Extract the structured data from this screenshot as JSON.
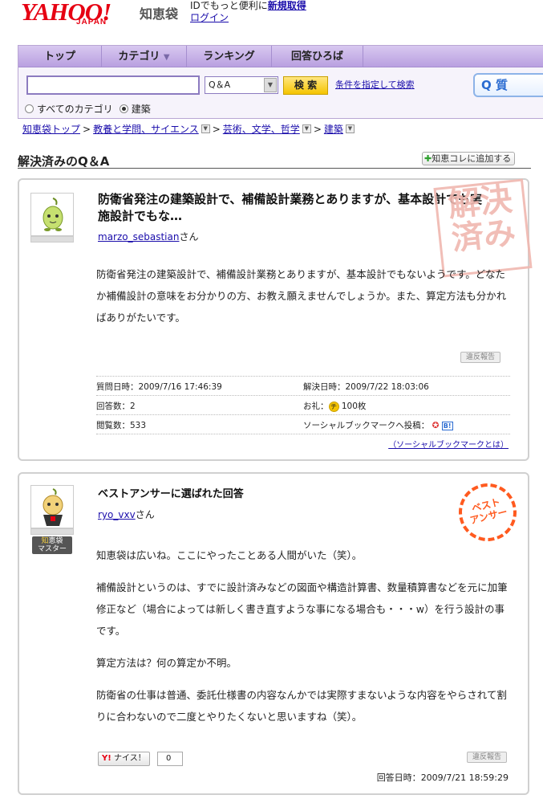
{
  "header": {
    "logo_text": "YAHOO!",
    "logo_sub": "JAPAN",
    "service_name": "知恵袋",
    "promo_text": "IDでもっと便利に",
    "register_link": "新規取得",
    "login_link": "ログイン"
  },
  "nav": {
    "tabs": [
      {
        "label": "トップ",
        "has_dropdown": false
      },
      {
        "label": "カテゴリ",
        "has_dropdown": true
      },
      {
        "label": "ランキング",
        "has_dropdown": false
      },
      {
        "label": "回答ひろば",
        "has_dropdown": false
      }
    ],
    "search_value": "",
    "search_scope": "Q＆A",
    "search_button": "検 索",
    "advanced_link": "条件を指定して検索",
    "ask_button": "質",
    "radio_all": "すべてのカテゴリ",
    "radio_current": "建築",
    "radio_selected": "建築"
  },
  "breadcrumb": [
    "知恵袋トップ",
    "教養と学問、サイエンス",
    "芸術、文学、哲学",
    "建築"
  ],
  "section": {
    "title": "解決済みのQ＆A",
    "add_button": "知恵コレに追加する"
  },
  "question": {
    "title": "防衛省発注の建築設計で、補備設計業務とありますが、基本設計でも実施設計でもな…",
    "user": "marzo_sebastian",
    "user_suffix": "さん",
    "stamp": "解決済み",
    "body": "防衛省発注の建築設計で、補備設計業務とありますが、基本設計でもないようです。どなたか補備設計の意味をお分かりの方、お教え願えませんでしょうか。また、算定方法も分かればありがたいです。",
    "report_label": "違反報告",
    "asked_label": "質問日時：",
    "asked_value": "2009/7/16 17:46:39",
    "solved_label": "解決日時：",
    "solved_value": "2009/7/22 18:03:06",
    "answers_label": "回答数：",
    "answers_value": "2",
    "reward_label": "お礼：",
    "reward_value": "100枚",
    "views_label": "閲覧数：",
    "views_value": "533",
    "social_label": "ソーシャルブックマークへ投稿：",
    "social_note": "（ソーシャルブックマークとは）"
  },
  "answer": {
    "heading": "ベストアンサーに選ばれた回答",
    "user": "ryo_vxv",
    "user_suffix": "さん",
    "stamp": "ベストアンサー",
    "badge_line1_a": "知",
    "badge_line1_b": "恵袋",
    "badge_line2": "マスター",
    "paragraphs": [
      "知恵袋は広いね。ここにやったことある人間がいた（笑）。",
      "補備設計というのは、すでに設計済みなどの図面や構造計算書、数量積算書などを元に加筆修正など（場合によっては新しく書き直すような事になる場合も・・・w）を行う設計の事です。",
      "算定方法は？何の算定か不明。",
      "防衛省の仕事は普通、委託仕様書の内容なんかでは実際すまないような内容をやらされて割りに合わないので二度とやりたくないと思いますね（笑）。"
    ],
    "nice_label": "ナイス！",
    "nice_count": "0",
    "report_label": "違反報告",
    "answered_label": "回答日時：",
    "answered_value": "2009/7/21 18:59:29"
  }
}
